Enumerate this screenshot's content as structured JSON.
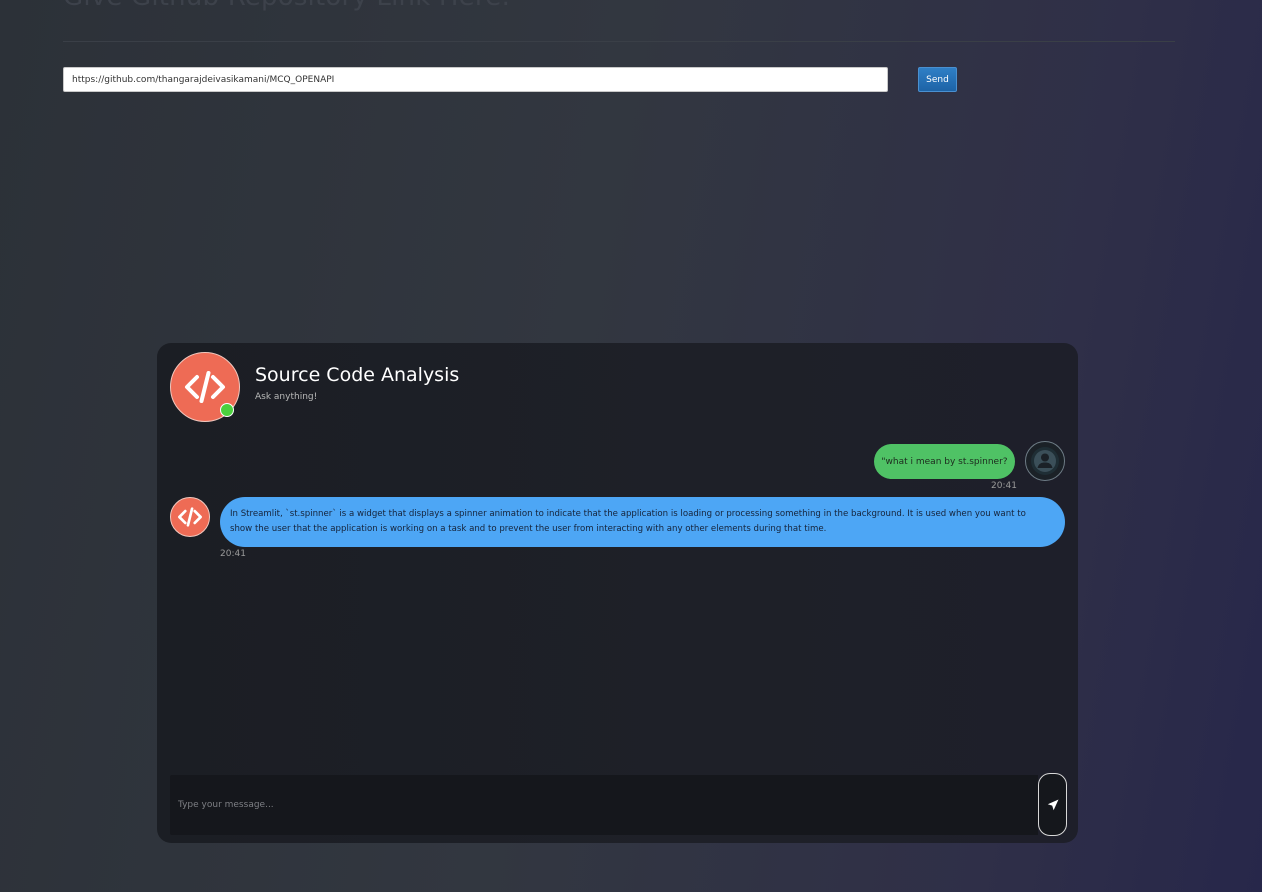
{
  "page": {
    "heading": "Give Github Repository Link Here:"
  },
  "repo_form": {
    "url_value": "https://github.com/thangarajdeivasikamani/MCQ_OPENAPI",
    "send_label": "Send"
  },
  "chat": {
    "title": "Source Code Analysis",
    "subtitle": "Ask anything!",
    "messages": [
      {
        "sender": "user",
        "text": "\"what i mean by st.spinner?",
        "time": "20:41"
      },
      {
        "sender": "bot",
        "text": "In Streamlit, `st.spinner` is a widget that displays a spinner animation to indicate that the application is loading or processing something in the background. It is used when you want to show the user that the application is working on a task and to prevent the user from interacting with any other elements during that time.",
        "time": "20:41"
      }
    ],
    "input_placeholder": "Type your message...",
    "input_value": ""
  },
  "icons": {
    "bot_avatar": "code-brackets-icon",
    "status": "online-dot",
    "user_avatar": "user-silhouette-icon",
    "send": "paper-plane-icon"
  },
  "colors": {
    "bot_avatar": "#ee6b55",
    "online_status": "#4cd13e",
    "user_bubble": "#4fc265",
    "bot_bubble": "#4da6f5",
    "send_button": "#1d63a6"
  }
}
